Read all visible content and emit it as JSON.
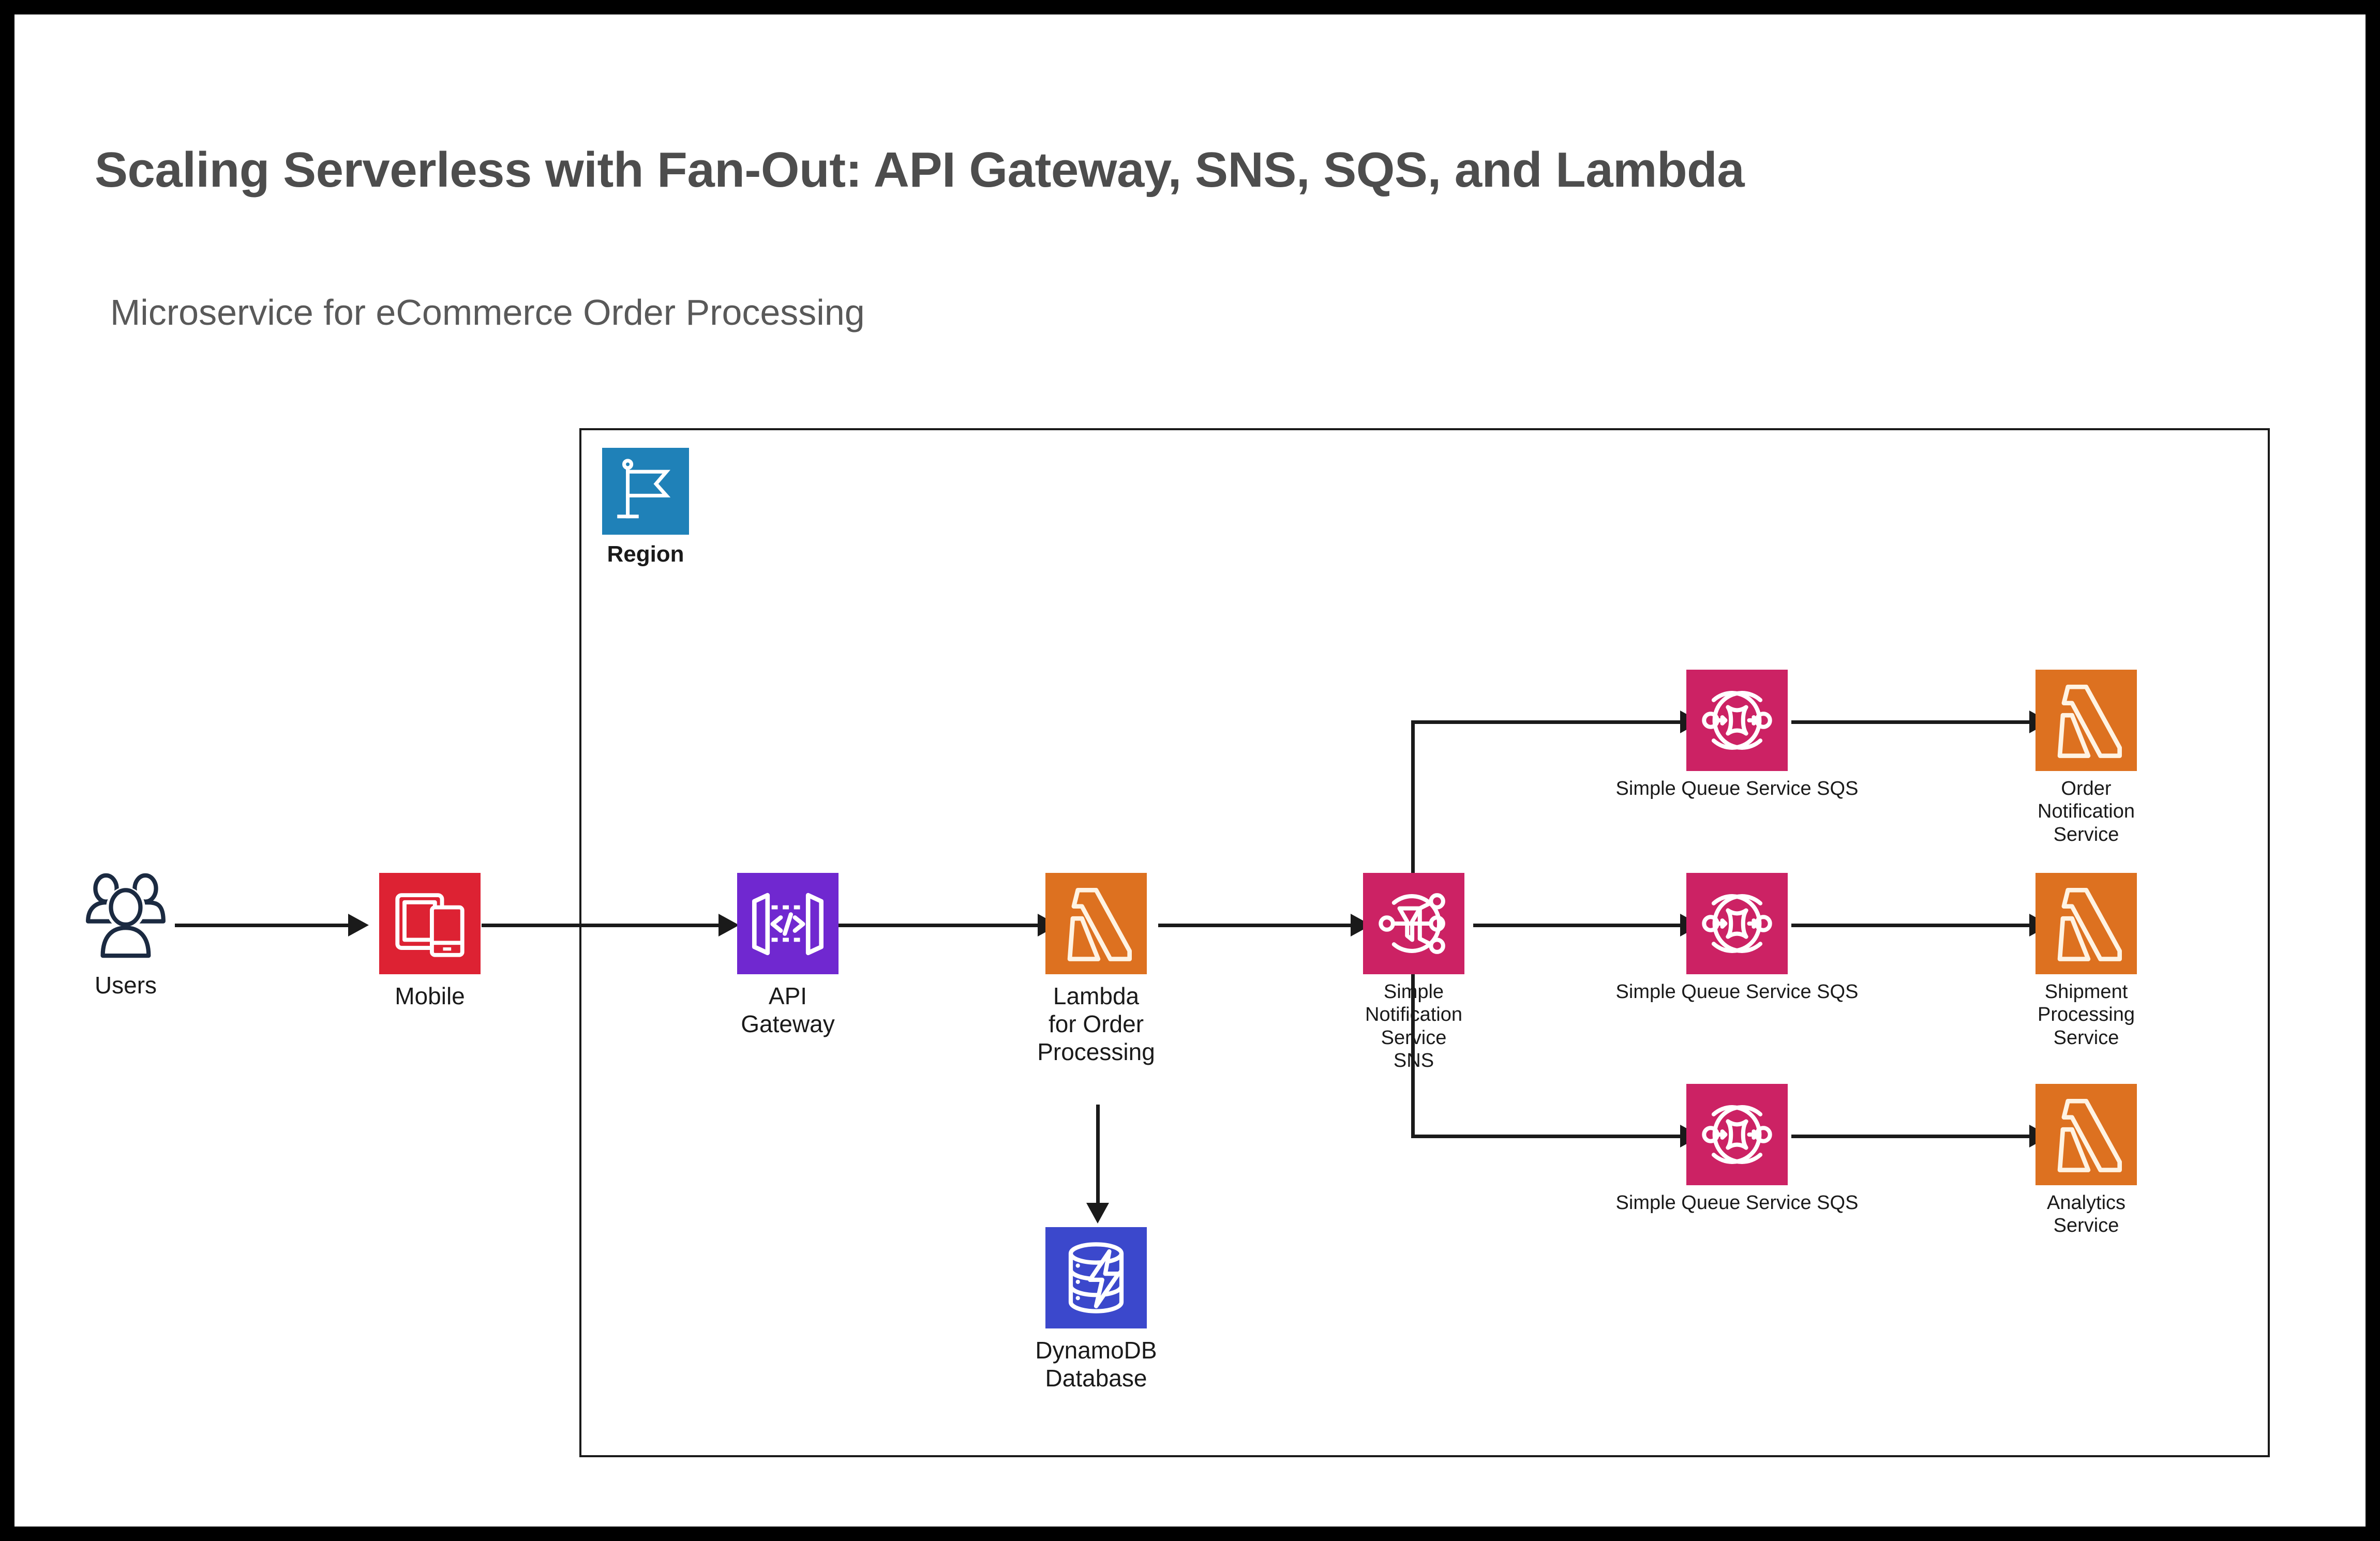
{
  "page": {
    "title": "Scaling Serverless with Fan-Out: API Gateway, SNS, SQS, and Lambda",
    "subtitle": "Microservice for eCommerce Order Processing"
  },
  "colors": {
    "title_text": "#4d4d4d",
    "subtitle_text": "#595959",
    "connector": "#1a1a1a",
    "region_border": "#1a1a1a",
    "mobile": "#DD2233",
    "region": "#1F81B8",
    "api_gateway": "#7028D0",
    "lambda": "#DD7120",
    "sns": "#CC2264",
    "sqs": "#CC2264",
    "dynamodb": "#3B48CC",
    "users_outline": "#1B2A41",
    "icon_glyph": "#FFFFFF"
  },
  "region": {
    "label": "Region",
    "icon": "flag-icon"
  },
  "nodes": [
    {
      "id": "users",
      "label": "Users",
      "icon": "users-icon",
      "style": "outline"
    },
    {
      "id": "mobile",
      "label": "Mobile",
      "icon": "mobile-devices-icon",
      "style": "tile",
      "color": "#DD2233"
    },
    {
      "id": "api-gateway",
      "label": "API\nGateway",
      "icon": "api-gateway-icon",
      "style": "tile",
      "color": "#7028D0"
    },
    {
      "id": "lambda-order",
      "label": "Lambda\nfor Order\nProcessing",
      "icon": "lambda-icon",
      "style": "tile",
      "color": "#DD7120"
    },
    {
      "id": "dynamodb",
      "label": "DynamoDB\nDatabase",
      "icon": "dynamodb-icon",
      "style": "tile",
      "color": "#3B48CC"
    },
    {
      "id": "sns",
      "label": "Simple\nNotification\nService SNS",
      "icon": "sns-icon",
      "style": "tile",
      "color": "#CC2264"
    },
    {
      "id": "sqs-1",
      "label": "Simple Queue Service SQS",
      "icon": "sqs-icon",
      "style": "tile",
      "color": "#CC2264"
    },
    {
      "id": "sqs-2",
      "label": "Simple Queue Service SQS",
      "icon": "sqs-icon",
      "style": "tile",
      "color": "#CC2264"
    },
    {
      "id": "sqs-3",
      "label": "Simple Queue Service SQS",
      "icon": "sqs-icon",
      "style": "tile",
      "color": "#CC2264"
    },
    {
      "id": "lambda-order-notification",
      "label": "Order\nNotification\nService",
      "icon": "lambda-icon",
      "style": "tile",
      "color": "#DD7120"
    },
    {
      "id": "lambda-shipment",
      "label": "Shipment\nProcessing\nService",
      "icon": "lambda-icon",
      "style": "tile",
      "color": "#DD7120"
    },
    {
      "id": "lambda-analytics",
      "label": "Analytics\nService",
      "icon": "lambda-icon",
      "style": "tile",
      "color": "#DD7120"
    }
  ],
  "connections": [
    {
      "from": "users",
      "to": "mobile",
      "kind": "arrow-right"
    },
    {
      "from": "mobile",
      "to": "api-gateway",
      "kind": "arrow-right"
    },
    {
      "from": "api-gateway",
      "to": "lambda-order",
      "kind": "arrow-right"
    },
    {
      "from": "lambda-order",
      "to": "dynamodb",
      "kind": "arrow-down"
    },
    {
      "from": "lambda-order",
      "to": "sns",
      "kind": "arrow-right"
    },
    {
      "from": "sns",
      "to": "sqs-1",
      "kind": "elbow-up-right"
    },
    {
      "from": "sns",
      "to": "sqs-2",
      "kind": "arrow-right"
    },
    {
      "from": "sns",
      "to": "sqs-3",
      "kind": "elbow-down-right"
    },
    {
      "from": "sqs-1",
      "to": "lambda-order-notification",
      "kind": "arrow-right"
    },
    {
      "from": "sqs-2",
      "to": "lambda-shipment",
      "kind": "arrow-right"
    },
    {
      "from": "sqs-3",
      "to": "lambda-analytics",
      "kind": "arrow-right"
    }
  ]
}
